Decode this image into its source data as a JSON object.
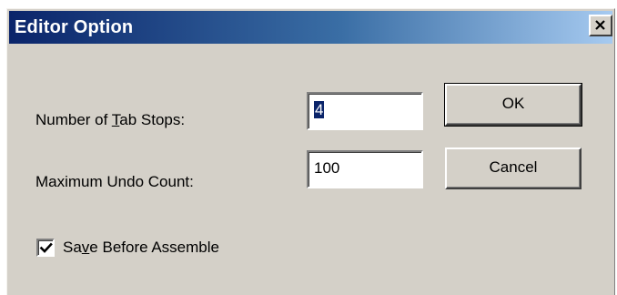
{
  "window": {
    "title": "Editor Option"
  },
  "fields": {
    "tab_stops": {
      "label_pre": "Number of ",
      "label_accel": "T",
      "label_post": "ab Stops:",
      "value": "4"
    },
    "undo_count": {
      "label": "Maximum Undo Count:",
      "value": "100"
    }
  },
  "checkbox": {
    "label_pre": "Sa",
    "label_accel": "v",
    "label_post": "e Before Assemble",
    "checked": true
  },
  "buttons": {
    "ok": "OK",
    "cancel": "Cancel"
  },
  "icons": {
    "close": "close-icon",
    "check": "checkmark-icon"
  },
  "colors": {
    "title_start": "#0a246a",
    "title_end": "#a6caf0",
    "dialog_bg": "#d4d0c8"
  }
}
